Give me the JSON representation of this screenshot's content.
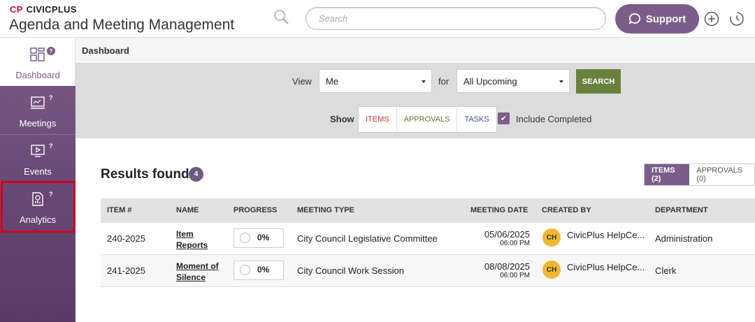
{
  "header": {
    "brand": "CIVICPLUS",
    "brand_mark": "CP",
    "app_title": "Agenda and Meeting Management",
    "search_placeholder": "Search",
    "support_label": "Support"
  },
  "sidebar": {
    "items": [
      {
        "label": "Dashboard",
        "help": "?"
      },
      {
        "label": "Meetings",
        "help": "?"
      },
      {
        "label": "Events",
        "help": "?"
      },
      {
        "label": "Analytics",
        "help": "?"
      }
    ]
  },
  "breadcrumb": "Dashboard",
  "filters": {
    "view_label": "View",
    "view_value": "Me",
    "for_label": "for",
    "for_value": "All Upcoming",
    "search_button": "SEARCH",
    "show_label": "Show",
    "show_options": [
      "ITEMS",
      "APPROVALS",
      "TASKS"
    ],
    "include_completed": "Include Completed",
    "colors": {
      "items": "#c0392b",
      "approvals": "#5a7a2e",
      "tasks": "#3b4f8c"
    }
  },
  "results": {
    "label": "Results found:",
    "count": "4",
    "tabs": [
      "ITEMS (2)",
      "APPROVALS (0)"
    ]
  },
  "table": {
    "headers": [
      "ITEM #",
      "NAME",
      "PROGRESS",
      "MEETING TYPE",
      "MEETING DATE",
      "CREATED BY",
      "DEPARTMENT"
    ],
    "rows": [
      {
        "item": "240-2025",
        "name_1": "Item",
        "name_2": "Reports",
        "progress": "0%",
        "meeting_type": "City Council Legislative Committee",
        "date": "05/06/2025",
        "time": "06:00 PM",
        "initials": "CH",
        "created_by": "CivicPlus HelpCe...",
        "department": "Administration"
      },
      {
        "item": "241-2025",
        "name_1": "Moment of",
        "name_2": "Silence",
        "progress": "0%",
        "meeting_type": "City Council Work Session",
        "date": "08/08/2025",
        "time": "06:00 PM",
        "initials": "CH",
        "created_by": "CivicPlus HelpCe...",
        "department": "Clerk"
      }
    ]
  }
}
